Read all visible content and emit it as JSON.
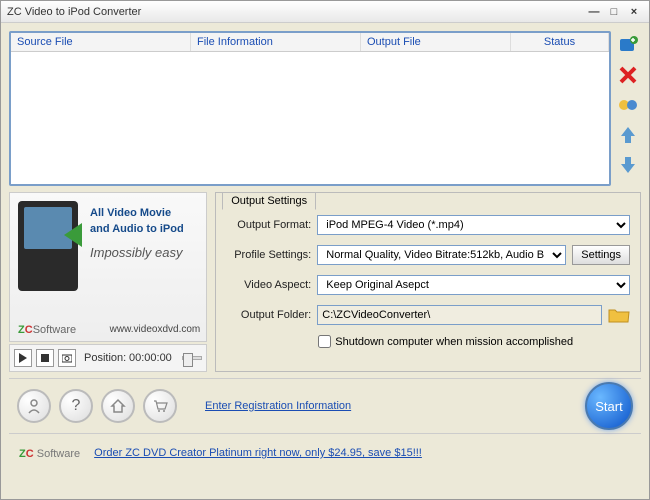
{
  "titlebar": {
    "title": "ZC Video to iPod Converter"
  },
  "filelist": {
    "cols": {
      "source": "Source File",
      "info": "File Information",
      "output": "Output File",
      "status": "Status"
    }
  },
  "promo": {
    "line1": "All Video Movie",
    "line2": "and Audio to iPod",
    "tag": "Impossibly easy",
    "brand_z": "Z",
    "brand_c": "C",
    "brand_s": "Software",
    "url": "www.videoxdvd.com"
  },
  "player": {
    "pos_label": "Position:",
    "pos_value": "00:00:00"
  },
  "settings": {
    "tab": "Output Settings",
    "format_label": "Output Format:",
    "format_value": "iPod MPEG-4 Video (*.mp4)",
    "profile_label": "Profile Settings:",
    "profile_value": "Normal Quality, Video Bitrate:512kb, Audio B",
    "settings_btn": "Settings",
    "aspect_label": "Video Aspect:",
    "aspect_value": "Keep Original Asepct",
    "folder_label": "Output Folder:",
    "folder_value": "C:\\ZCVideoConverter\\",
    "shutdown": "Shutdown computer when mission accomplished"
  },
  "bottom": {
    "reg": "Enter Registration Information",
    "start": "Start"
  },
  "footer": {
    "brand_z": "Z",
    "brand_c": "C",
    "brand_s": " Software",
    "order": "Order ZC DVD Creator Platinum right now, only $24.95, save $15!!!"
  }
}
